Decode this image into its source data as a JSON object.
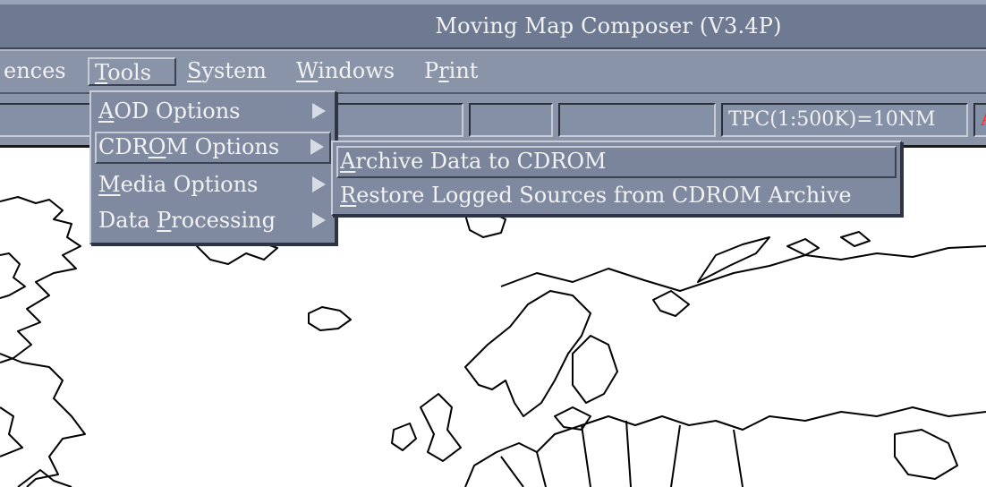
{
  "window": {
    "title": "Moving Map Composer  (V3.4P)"
  },
  "menubar": {
    "items": [
      {
        "label": "ences",
        "mnemonic": ""
      },
      {
        "label": "Tools",
        "mnemonic": "T"
      },
      {
        "label": "System",
        "mnemonic": "S"
      },
      {
        "label": "Windows",
        "mnemonic": "W"
      },
      {
        "label": "Print",
        "mnemonic": "r"
      }
    ],
    "active": "Tools"
  },
  "toolbar": {
    "fields": [
      "",
      "",
      "",
      "",
      "TPC(1:500K)=10NM",
      "A"
    ],
    "accent_color": "#ff2a2a"
  },
  "tools_menu": {
    "items": [
      {
        "pre": "",
        "u": "A",
        "post": "OD Options",
        "submenu": true
      },
      {
        "pre": "CDR",
        "u": "O",
        "post": "M  Options",
        "submenu": true
      },
      {
        "pre": "",
        "u": "M",
        "post": "edia Options",
        "submenu": true
      },
      {
        "pre": "Data ",
        "u": "P",
        "post": "rocessing",
        "submenu": true
      }
    ],
    "selected_index": 1
  },
  "cdrom_submenu": {
    "items": [
      {
        "pre": "",
        "u": "A",
        "post": "rchive Data to CDROM"
      },
      {
        "pre": "",
        "u": "R",
        "post": "estore Logged Sources from CDROM Archive"
      }
    ],
    "selected_index": 0
  },
  "map": {
    "style": "world coastline outline",
    "line_color": "#000000",
    "background": "#ffffff"
  }
}
